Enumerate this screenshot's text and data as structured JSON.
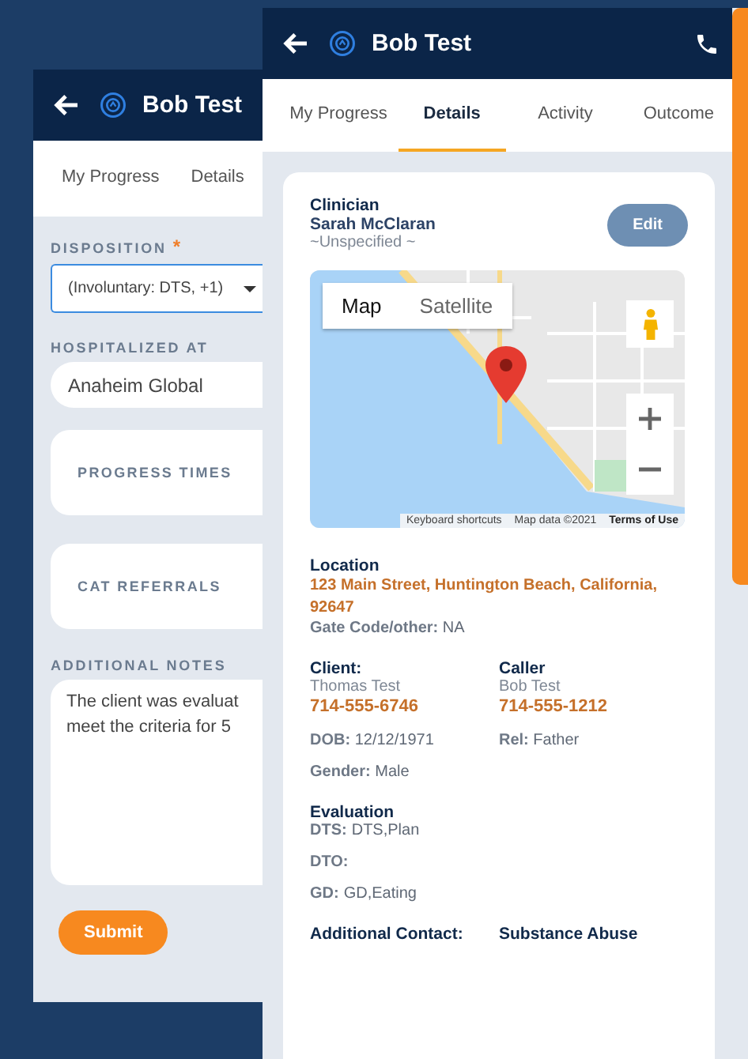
{
  "back_screen": {
    "title": "Bob Test",
    "tabs": [
      {
        "label": "My Progress",
        "selected": false
      },
      {
        "label": "Details",
        "selected": false
      }
    ],
    "disposition": {
      "label": "DISPOSITION",
      "required_mark": "*",
      "value": "(Involuntary: DTS, +1)"
    },
    "hospitalized": {
      "label": "HOSPITALIZED AT",
      "value": "Anaheim Global"
    },
    "sections": [
      "PROGRESS TIMES",
      "CAT REFERRALS"
    ],
    "notes": {
      "label": "ADDITIONAL NOTES",
      "lines": [
        "The client was evaluat",
        "meet the criteria for 5"
      ]
    },
    "submit": "Submit"
  },
  "front_screen": {
    "title": "Bob Test",
    "tabs": [
      {
        "label": "My Progress",
        "selected": false
      },
      {
        "label": "Details",
        "selected": true
      },
      {
        "label": "Activity",
        "selected": false
      },
      {
        "label": "Outcome",
        "selected": false
      }
    ],
    "clinician": {
      "heading": "Clinician",
      "name": "Sarah McClaran",
      "role": "~Unspecified ~",
      "edit": "Edit"
    },
    "map": {
      "types": [
        {
          "label": "Map",
          "selected": true
        },
        {
          "label": "Satellite",
          "selected": false
        }
      ],
      "attribution": [
        "Keyboard shortcuts",
        "Map data ©2021",
        "Terms of Use"
      ]
    },
    "location": {
      "heading": "Location",
      "address": "123 Main Street, Huntington Beach, California, 92647",
      "fields": [
        {
          "label": "Gate Code/other:",
          "value": "NA"
        }
      ]
    },
    "people": [
      {
        "heading": "Client:",
        "name": "Thomas Test",
        "phone": "714-555-6746",
        "fields": [
          {
            "label": "DOB:",
            "value": "12/12/1971"
          },
          {
            "label": "Gender:",
            "value": "Male"
          }
        ]
      },
      {
        "heading": "Caller",
        "name": "Bob Test",
        "phone": "714-555-1212",
        "fields": [
          {
            "label": "Rel:",
            "value": "Father"
          }
        ]
      }
    ],
    "evaluation": {
      "heading": "Evaluation",
      "fields": [
        {
          "label": "DTS:",
          "value": "DTS,Plan"
        },
        {
          "label": "DTO:"
        },
        {
          "label": "GD:",
          "value": "GD,Eating"
        }
      ]
    },
    "more_headings": [
      "Additional Contact:",
      "Substance Abuse"
    ]
  }
}
